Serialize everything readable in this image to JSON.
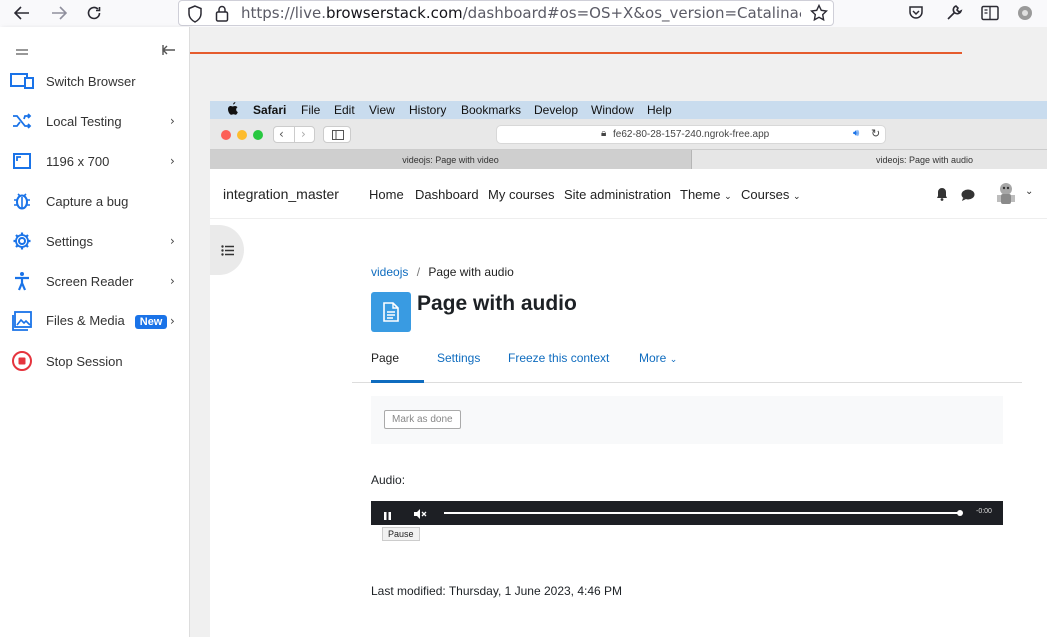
{
  "browser": {
    "url_prefix": "https://live.",
    "url_domain": "browserstack.com",
    "url_rest": "/dashboard#os=OS+X&os_version=Catalina&brows"
  },
  "sidebar": {
    "items": [
      {
        "label": "Switch Browser",
        "icon": "switch-browser-icon"
      },
      {
        "label": "Local Testing",
        "icon": "local-testing-icon"
      },
      {
        "label": "1196 x 700",
        "icon": "resolution-icon"
      },
      {
        "label": "Capture a bug",
        "icon": "bug-icon"
      },
      {
        "label": "Settings",
        "icon": "gear-icon"
      },
      {
        "label": "Screen Reader",
        "icon": "accessibility-icon"
      },
      {
        "label": "Files & Media",
        "icon": "image-icon",
        "badge": "New"
      },
      {
        "label": "Stop Session",
        "icon": "stop-icon"
      }
    ]
  },
  "mac_menu": {
    "app": "Safari",
    "items": [
      "File",
      "Edit",
      "View",
      "History",
      "Bookmarks",
      "Develop",
      "Window",
      "Help"
    ]
  },
  "safari": {
    "url": "fe62-80-28-157-240.ngrok-free.app",
    "tabs": [
      "videojs: Page with video",
      "videojs: Page with audio"
    ]
  },
  "site": {
    "brand": "integration_master",
    "nav": [
      "Home",
      "Dashboard",
      "My courses",
      "Site administration",
      "Theme",
      "Courses"
    ],
    "breadcrumb_parent": "videojs",
    "breadcrumb_sep": "/",
    "breadcrumb_current": "Page with audio",
    "page_title": "Page with audio",
    "tabs": [
      "Page",
      "Settings",
      "Freeze this context",
      "More"
    ],
    "mark_done": "Mark as done",
    "audio_label": "Audio:",
    "player_time": "-0:00",
    "tooltip": "Pause",
    "last_modified": "Last modified: Thursday, 1 June 2023, 4:46 PM"
  },
  "colors": {
    "accent_blue": "#1a73e8",
    "orange_line": "#e55b2d",
    "moodle_link": "#0f6cbf"
  }
}
